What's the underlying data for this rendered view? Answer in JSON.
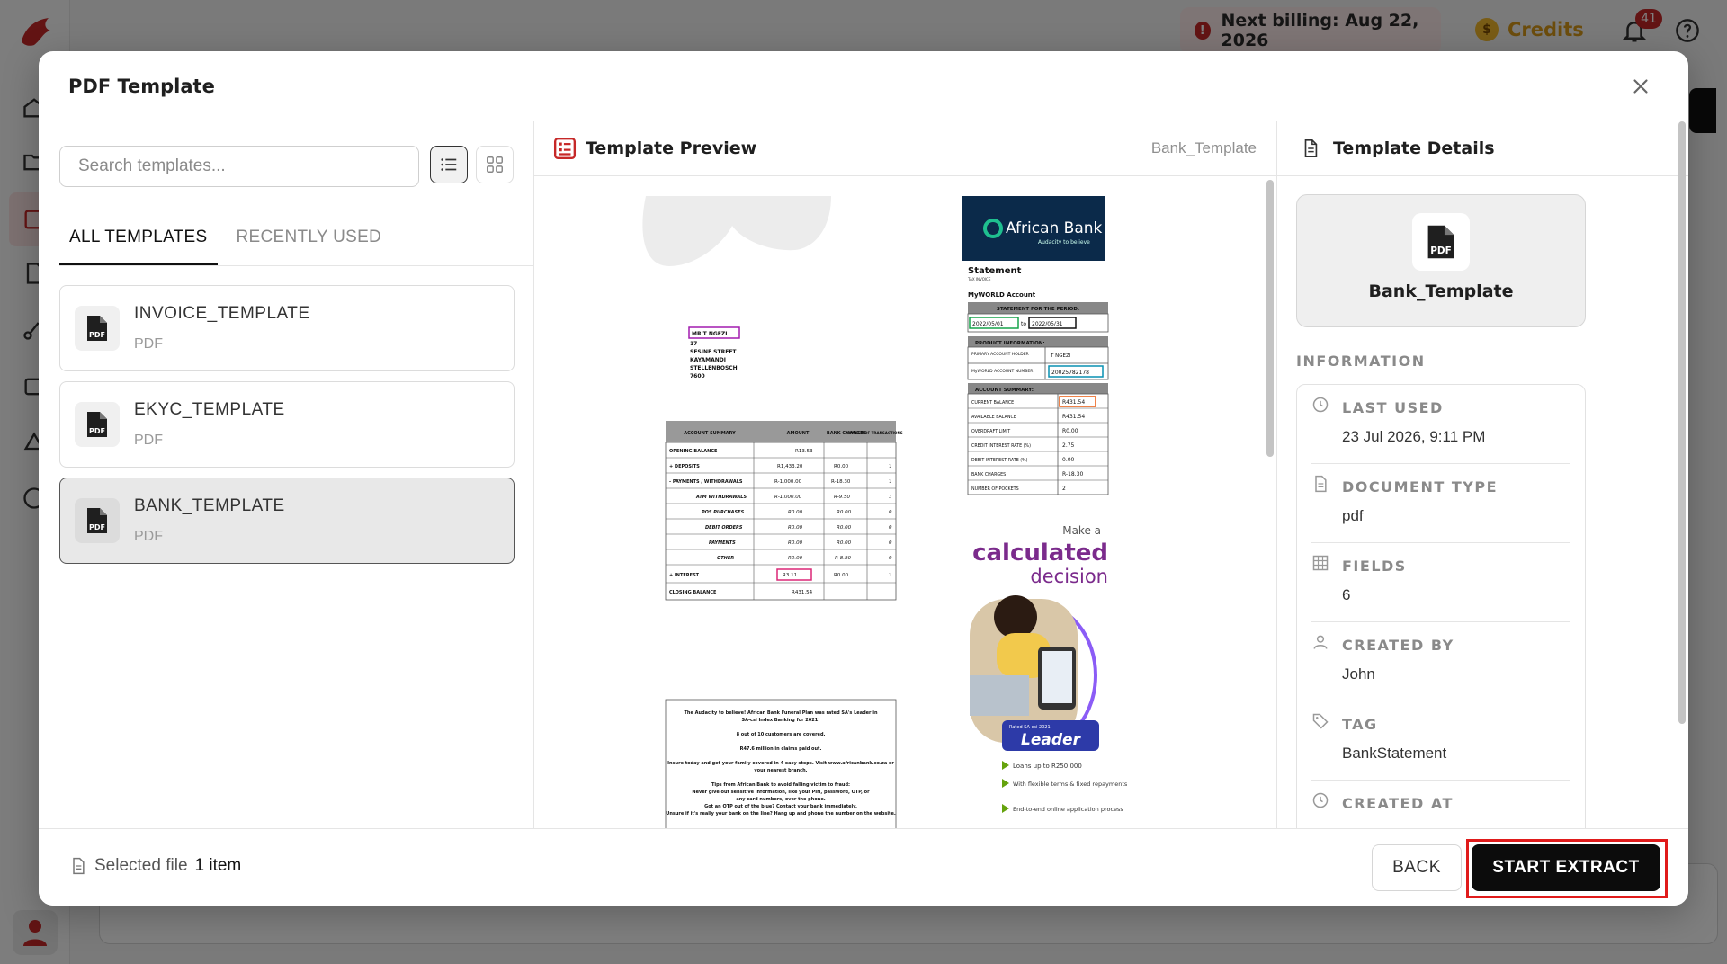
{
  "topbar": {
    "billing_icon": "alert-icon",
    "billing_text": "Next billing: Aug 22, 2026",
    "credits_label": "Credits",
    "credits_icon": "coin-icon",
    "notification_count": "41"
  },
  "colors": {
    "accent": "#C62828",
    "credits": "#D99A1B",
    "primary_button": "#0C0C0C",
    "highlight_outline": "#E01B1B"
  },
  "modal": {
    "title": "PDF Template",
    "search_placeholder": "Search templates...",
    "tabs": [
      {
        "label": "ALL TEMPLATES",
        "active": true
      },
      {
        "label": "RECENTLY USED",
        "active": false
      }
    ],
    "templates": [
      {
        "name": "INVOICE_TEMPLATE",
        "type": "PDF",
        "selected": false
      },
      {
        "name": "EKYC_TEMPLATE",
        "type": "PDF",
        "selected": false
      },
      {
        "name": "BANK_TEMPLATE",
        "type": "PDF",
        "selected": true
      }
    ],
    "preview": {
      "title": "Template Preview",
      "file_name": "Bank_Template",
      "document": {
        "logo_name": "African Bank",
        "logo_tagline": "Audacity to believe",
        "statement_title": "Statement",
        "statement_sub1": "TAX INVOICE",
        "statement_sub2": "MyWORLD Account",
        "address": [
          "MR T NGEZI",
          "17",
          "SESINE STREET",
          "KAYAMANDI",
          "STELLENBOSCH",
          "7600"
        ],
        "period_header": "STATEMENT FOR THE PERIOD:",
        "period_from": "2022/05/01",
        "period_to": "2022/05/31",
        "product_header": "PRODUCT INFORMATION:",
        "primary_holder_label": "PRIMARY ACCOUNT HOLDER",
        "primary_holder_value": "T NGEZI",
        "account_number_label": "MyWORLD ACCOUNT NUMBER",
        "account_number_value": "20025782178",
        "summary_header": "ACCOUNT SUMMARY:",
        "summary_rows": [
          {
            "label": "CURRENT BALANCE",
            "value": "R431.54"
          },
          {
            "label": "AVAILABLE BALANCE",
            "value": "R431.54"
          },
          {
            "label": "OVERDRAFT LIMIT",
            "value": "R0.00"
          },
          {
            "label": "CREDIT INTEREST RATE (%)",
            "value": "2.75"
          },
          {
            "label": "DEBIT INTEREST RATE (%)",
            "value": "0.00"
          },
          {
            "label": "BANK CHARGES",
            "value": "R-18.30"
          },
          {
            "label": "NUMBER OF POCKETS",
            "value": "2"
          }
        ],
        "table_headers": [
          "ACCOUNT SUMMARY",
          "AMOUNT",
          "BANK CHARGES",
          "NUMBER OF TRANSACTIONS"
        ],
        "table_rows": [
          [
            "OPENING BALANCE",
            "R13.53",
            "",
            ""
          ],
          [
            "+ DEPOSITS",
            "R1,433.20",
            "R0.00",
            "1"
          ],
          [
            "- PAYMENTS / WITHDRAWALS",
            "R-1,000.00",
            "R-18.30",
            "1"
          ],
          [
            "ATM WITHDRAWALS",
            "R-1,000.00",
            "R-9.50",
            "1"
          ],
          [
            "POS PURCHASES",
            "R0.00",
            "R0.00",
            "0"
          ],
          [
            "DEBIT ORDERS",
            "R0.00",
            "R0.00",
            "0"
          ],
          [
            "PAYMENTS",
            "R0.00",
            "R0.00",
            "0"
          ],
          [
            "OTHER",
            "R0.00",
            "R-8.80",
            "0"
          ],
          [
            "+ INTEREST",
            "R3.11",
            "R0.00",
            "1"
          ],
          [
            "CLOSING BALANCE",
            "R431.54",
            "",
            ""
          ]
        ],
        "promo_make": "Make a",
        "promo_big": "calculated",
        "promo_decision": "decision",
        "promo_badge_top": "Rated SA-csi 2021",
        "promo_badge": "Leader",
        "promo_bullets": [
          "Loans up to R250 000",
          "With flexible terms & fixed repayments",
          "End-to-end online application process"
        ],
        "notice_lines": [
          "The Audacity to believe! African Bank Funeral Plan was rated SA's Leader in",
          "SA-csi Index Banking for 2021!",
          "8 out of 10 customers are covered.",
          "R47.6 million in claims paid out.",
          "Insure today and get your family covered in 4 easy steps. Visit www.africanbank.co.za or",
          "your nearest branch.",
          "Tips from African Bank to avoid falling victim to fraud:",
          "Never give out sensitive information, like your PIN, password, OTP, or",
          "any card numbers, over the phone.",
          "Got an OTP out of the blue? Contact your bank immediately.",
          "Unsure if it's really your bank on the line? Hang up and phone the number on the website."
        ]
      }
    },
    "details": {
      "title": "Template Details",
      "name": "Bank_Template",
      "info_heading": "INFORMATION",
      "rows": [
        {
          "icon": "clock-icon",
          "label": "LAST USED",
          "value": "23 Jul 2026, 9:11 PM"
        },
        {
          "icon": "document-icon",
          "label": "DOCUMENT TYPE",
          "value": "pdf"
        },
        {
          "icon": "grid-icon",
          "label": "FIELDS",
          "value": "6"
        },
        {
          "icon": "user-icon",
          "label": "CREATED BY",
          "value": "John"
        },
        {
          "icon": "tag-icon",
          "label": "TAG",
          "value": "BankStatement"
        },
        {
          "icon": "clock-icon",
          "label": "CREATED AT",
          "value": ""
        }
      ]
    },
    "footer": {
      "selected_label": "Selected file",
      "selected_count": "1 item",
      "back_label": "BACK",
      "start_label": "START EXTRACT"
    }
  }
}
